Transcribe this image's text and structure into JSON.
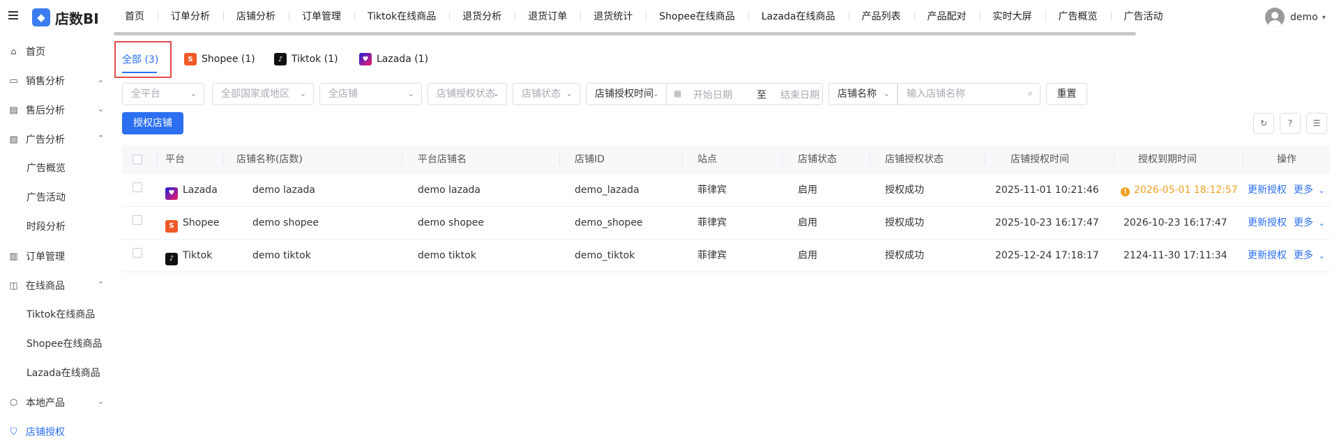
{
  "app": {
    "name": "店数BI",
    "logo_glyph": "◆"
  },
  "top_nav": [
    "首页",
    "订单分析",
    "店铺分析",
    "订单管理",
    "Tiktok在线商品",
    "退货分析",
    "退货订单",
    "退货统计",
    "Shopee在线商品",
    "Lazada在线商品",
    "产品列表",
    "产品配对",
    "实时大屏",
    "广告概览",
    "广告活动"
  ],
  "user": {
    "name": "demo"
  },
  "sidebar": {
    "home": "首页",
    "sales": "销售分析",
    "after_sales": "售后分析",
    "ads": "广告分析",
    "ads_overview": "广告概览",
    "ads_campaign": "广告活动",
    "ads_timeslot": "时段分析",
    "orders": "订单管理",
    "online_products": "在线商品",
    "tiktok_products": "Tiktok在线商品",
    "shopee_products": "Shopee在线商品",
    "lazada_products": "Lazada在线商品",
    "local_products": "本地产品",
    "store_auth": "店铺授权"
  },
  "tabs": [
    {
      "label": "全部 (3)"
    },
    {
      "label": "Shopee (1)"
    },
    {
      "label": "Tiktok (1)"
    },
    {
      "label": "Lazada (1)"
    }
  ],
  "filters": {
    "platform": "全平台",
    "region": "全部国家或地区",
    "store": "全店铺",
    "auth_status": "店铺授权状态",
    "store_status": "店铺状态",
    "auth_time": "店铺授权时间",
    "start_date": "开始日期",
    "to": "至",
    "end_date": "结束日期",
    "store_name_select": "店铺名称",
    "store_name_placeholder": "输入店铺名称",
    "reset": "重置"
  },
  "actions": {
    "authorize": "授权店铺"
  },
  "table": {
    "headers": {
      "platform": "平台",
      "store_name": "店铺名称(店数)",
      "platform_store": "平台店铺名",
      "store_id": "店铺ID",
      "site": "站点",
      "status": "店铺状态",
      "auth_status": "店铺授权状态",
      "auth_time": "店铺授权时间",
      "expire_time": "授权到期时间",
      "ops": "操作"
    },
    "rows": [
      {
        "platform": "Lazada",
        "store_name": "demo lazada",
        "platform_store": "demo lazada",
        "store_id": "demo_lazada",
        "site": "菲律宾",
        "status": "启用",
        "auth_status": "授权成功",
        "auth_time": "2025-11-01 10:21:46",
        "expire_time": "2026-05-01 18:12:57",
        "op_update": "更新授权",
        "op_more": "更多"
      },
      {
        "platform": "Shopee",
        "store_name": "demo shopee",
        "platform_store": "demo shopee",
        "store_id": "demo_shopee",
        "site": "菲律宾",
        "status": "启用",
        "auth_status": "授权成功",
        "auth_time": "2025-10-23 16:17:47",
        "expire_time": "2026-10-23 16:17:47",
        "op_update": "更新授权",
        "op_more": "更多"
      },
      {
        "platform": "Tiktok",
        "store_name": "demo tiktok",
        "platform_store": "demo tiktok",
        "store_id": "demo_tiktok",
        "site": "菲律宾",
        "status": "启用",
        "auth_status": "授权成功",
        "auth_time": "2025-12-24 17:18:17",
        "expire_time": "2124-11-30 17:11:34",
        "op_update": "更新授权",
        "op_more": "更多"
      }
    ]
  },
  "colors": {
    "primary": "#2c6ff0",
    "warning": "#f0a020",
    "highlight": "#e24a4a"
  }
}
